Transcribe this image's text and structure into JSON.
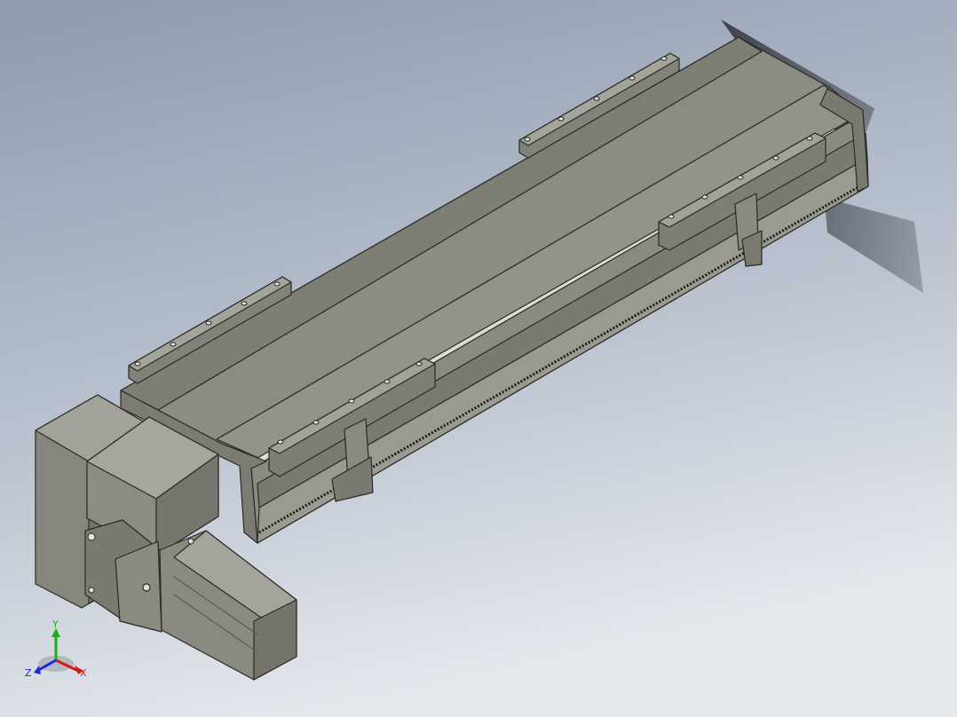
{
  "viewport": {
    "background_top": "#8f9db0",
    "background_bottom": "#e6e9ee"
  },
  "model": {
    "body_color": "#8a8a80",
    "body_light": "#9a9a90",
    "body_dark": "#6e6e66",
    "edge_color": "#2a2a26",
    "rail_color": "#d8d8d2"
  },
  "triad": {
    "x_label": "X",
    "y_label": "Y",
    "z_label": "Z",
    "x_color": "#d21a1a",
    "y_color": "#18b018",
    "z_color": "#1a2ad8"
  }
}
